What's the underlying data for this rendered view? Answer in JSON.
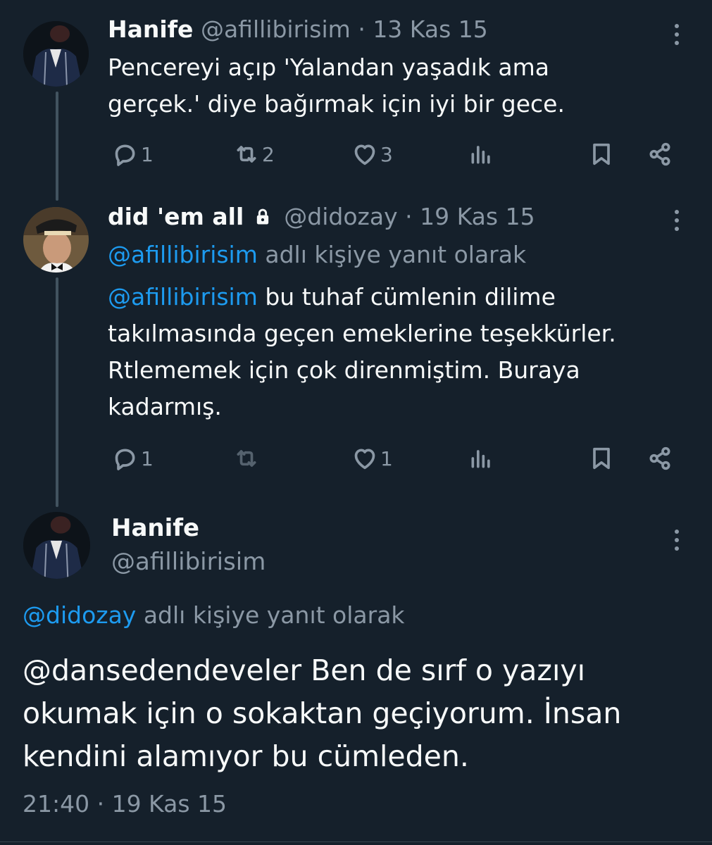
{
  "tweet1": {
    "name": "Hanife",
    "handle": "@afillibirisim",
    "separator": "·",
    "date": "13 Kas 15",
    "text_line1": "Pencereyi açıp 'Yalandan yaşadık ama",
    "text_line2": "gerçek.' diye bağırmak için iyi bir gece.",
    "replies": "1",
    "retweets": "2",
    "likes": "3"
  },
  "tweet2": {
    "name": "did 'em all",
    "handle": "@didozay",
    "separator": "·",
    "date": "19 Kas 15",
    "reply_to_handle": "@afillibirisim",
    "reply_to_suffix": " adlı kişiye yanıt olarak",
    "mention": "@afillibirisim",
    "text_line1_rest": " bu tuhaf cümlenin dilime",
    "text_line2": "takılmasında geçen emeklerine teşekkürler.",
    "text_line3": "Rtlememek için çok direnmiştim. Buraya",
    "text_line4": "kadarmış.",
    "replies": "1",
    "likes": "1"
  },
  "main_tweet": {
    "name": "Hanife",
    "handle": "@afillibirisim",
    "reply_to_handle": "@didozay",
    "reply_to_suffix": " adlı kişiye yanıt olarak",
    "text_line1": "@dansedendeveler Ben de sırf o yazıyı",
    "text_line2": "okumak için o sokaktan geçiyorum. İnsan",
    "text_line3": "kendini alamıyor bu cümleden.",
    "timestamp": "21:40 · 19 Kas 15"
  },
  "colors": {
    "background": "#15202b",
    "text": "#f7f9f9",
    "muted": "#8b98a5",
    "link": "#1d9bf0"
  },
  "icons": [
    "reply-icon",
    "retweet-icon",
    "like-icon",
    "views-icon",
    "bookmark-icon",
    "share-icon",
    "more-icon",
    "lock-icon"
  ]
}
